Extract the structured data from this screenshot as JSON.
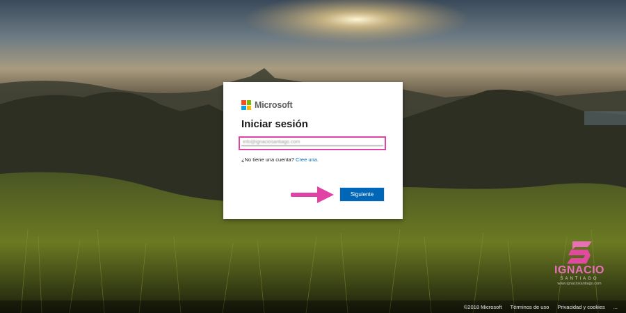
{
  "brand": {
    "name": "Microsoft",
    "logo_colors": [
      "#f25022",
      "#7fba00",
      "#00a4ef",
      "#ffb900"
    ]
  },
  "login": {
    "title": "Iniciar sesión",
    "email_value": "info@ignaciosantiago.com",
    "no_account_text": "¿No tiene una cuenta?",
    "create_link": "Cree una.",
    "next_button": "Siguiente"
  },
  "footer": {
    "copyright": "©2018 Microsoft",
    "terms": "Términos de uso",
    "privacy": "Privacidad y cookies",
    "more": "..."
  },
  "watermark": {
    "name": "IGNACIO",
    "sub": "SANTIAGO",
    "url": "www.ignaciosantiago.com"
  },
  "colors": {
    "accent": "#0067b8",
    "highlight": "#e042a6"
  }
}
